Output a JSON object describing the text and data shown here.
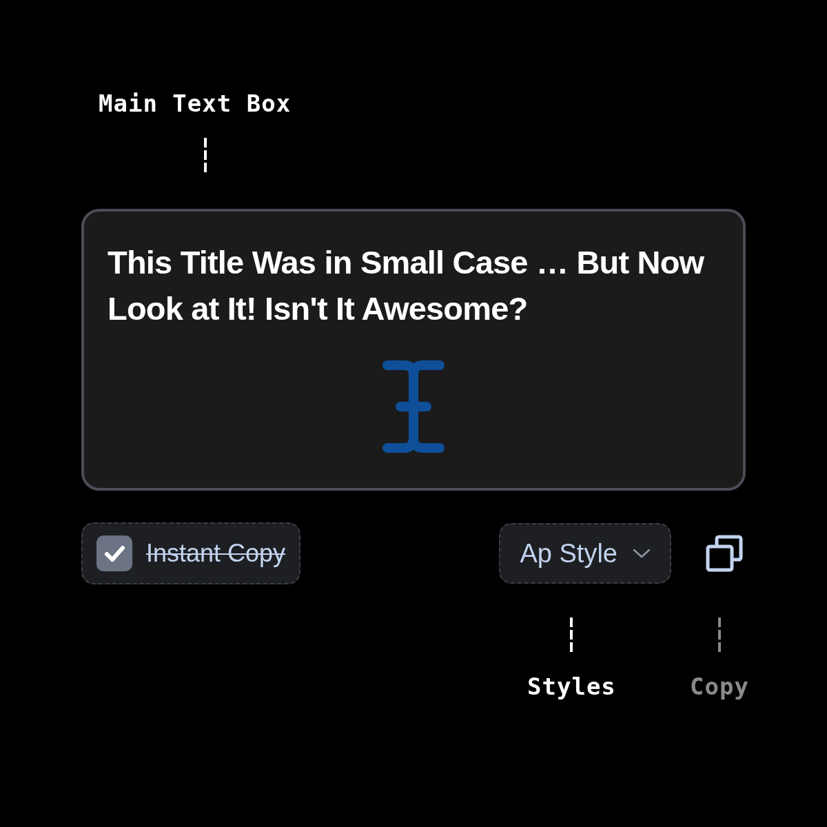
{
  "annotations": [
    {
      "label": "Main Text Box",
      "dimmed": false
    },
    {
      "label": "Styles",
      "dimmed": false
    },
    {
      "label": "Copy",
      "dimmed": true
    }
  ],
  "text_box": {
    "value": "This Title Was in Small Case … But Now Look at It! Isn't It Awesome?"
  },
  "instant_copy": {
    "label": "Instant Copy",
    "checked": true
  },
  "style_dropdown": {
    "value": "Ap Style"
  }
}
